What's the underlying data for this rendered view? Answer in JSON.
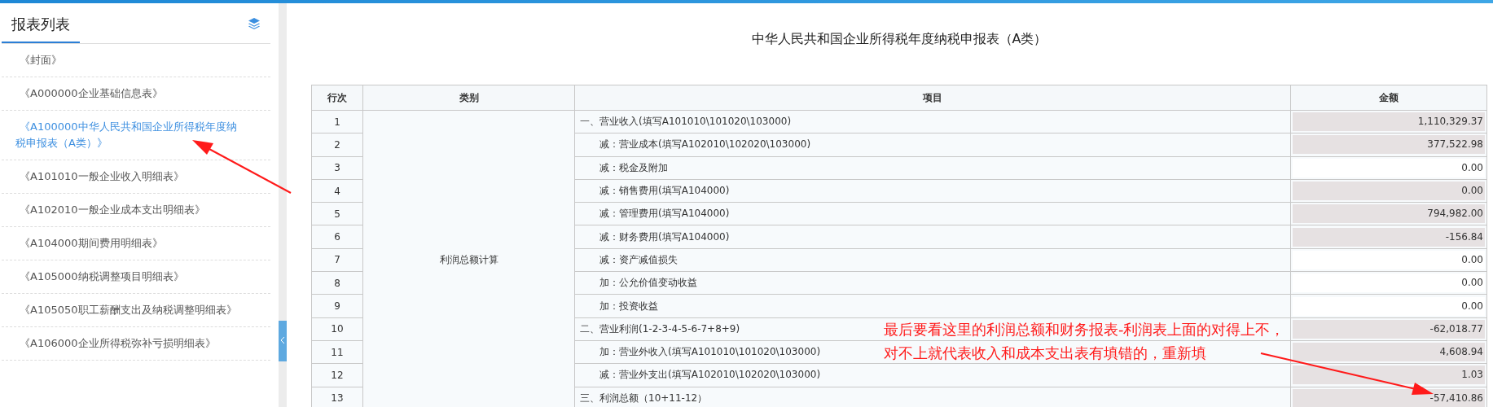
{
  "sidebar": {
    "title": "报表列表",
    "items": [
      {
        "label": "《封面》",
        "selected": false
      },
      {
        "label": "《A000000企业基础信息表》",
        "selected": false
      },
      {
        "label": "《A100000中华人民共和国企业所得税年度纳税申报表（A类）》",
        "selected": true
      },
      {
        "label": "《A101010一般企业收入明细表》",
        "selected": false
      },
      {
        "label": "《A102010一般企业成本支出明细表》",
        "selected": false
      },
      {
        "label": "《A104000期间费用明细表》",
        "selected": false
      },
      {
        "label": "《A105000纳税调整项目明细表》",
        "selected": false
      },
      {
        "label": "《A105050职工薪酬支出及纳税调整明细表》",
        "selected": false
      },
      {
        "label": "《A106000企业所得税弥补亏损明细表》",
        "selected": false
      }
    ]
  },
  "report": {
    "title": "中华人民共和国企业所得税年度纳税申报表（A类）",
    "columns": [
      "行次",
      "类别",
      "项目",
      "金额"
    ],
    "category": "利润总额计算",
    "rows": [
      {
        "line": "1",
        "kind": "section",
        "item": "一、营业收入(填写A101010\\101020\\103000)",
        "amount": "1,110,329.37",
        "readonly": true
      },
      {
        "line": "2",
        "kind": "entry",
        "item": "减：营业成本(填写A102010\\102020\\103000)",
        "amount": "377,522.98",
        "readonly": true
      },
      {
        "line": "3",
        "kind": "entry",
        "item": "减：税金及附加",
        "amount": "0.00",
        "readonly": false
      },
      {
        "line": "4",
        "kind": "entry",
        "item": "减：销售费用(填写A104000)",
        "amount": "0.00",
        "readonly": true
      },
      {
        "line": "5",
        "kind": "entry",
        "item": "减：管理费用(填写A104000)",
        "amount": "794,982.00",
        "readonly": true
      },
      {
        "line": "6",
        "kind": "entry",
        "item": "减：财务费用(填写A104000)",
        "amount": "-156.84",
        "readonly": true
      },
      {
        "line": "7",
        "kind": "entry",
        "item": "减：资产减值损失",
        "amount": "0.00",
        "readonly": false
      },
      {
        "line": "8",
        "kind": "entry",
        "item": "加：公允价值变动收益",
        "amount": "0.00",
        "readonly": false
      },
      {
        "line": "9",
        "kind": "entry",
        "item": "加：投资收益",
        "amount": "0.00",
        "readonly": false
      },
      {
        "line": "10",
        "kind": "section",
        "item": "二、营业利润(1-2-3-4-5-6-7+8+9)",
        "amount": "-62,018.77",
        "readonly": true
      },
      {
        "line": "11",
        "kind": "entry",
        "item": "加：营业外收入(填写A101010\\101020\\103000)",
        "amount": "4,608.94",
        "readonly": true
      },
      {
        "line": "12",
        "kind": "entry",
        "item": "减：营业外支出(填写A102010\\102020\\103000)",
        "amount": "1.03",
        "readonly": true
      },
      {
        "line": "13",
        "kind": "section",
        "item": "三、利润总额（10+11-12）",
        "amount": "-57,410.86",
        "readonly": true
      }
    ]
  },
  "annotation": {
    "lines": [
      "最后要看这里的利润总额和财务报表-利润表上面的对得上不，",
      "对不上就代表收入和成本支出表有填错的，重新填"
    ]
  }
}
